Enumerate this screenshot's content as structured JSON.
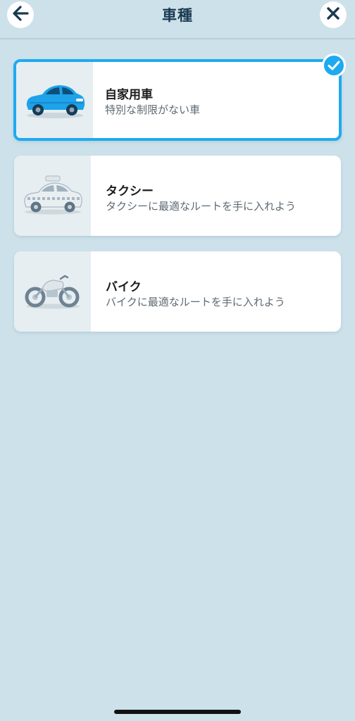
{
  "header": {
    "title": "車種"
  },
  "options": [
    {
      "name": "自家用車",
      "description": "特別な制限がない車",
      "icon": "car-icon",
      "selected": true
    },
    {
      "name": "タクシー",
      "description": "タクシーに最適なルートを手に入れよう",
      "icon": "taxi-icon",
      "selected": false
    },
    {
      "name": "バイク",
      "description": "バイクに最適なルートを手に入れよう",
      "icon": "motorcycle-icon",
      "selected": false
    }
  ],
  "colors": {
    "background": "#cde1ea",
    "accent": "#1eaaf1",
    "title": "#19394f"
  }
}
